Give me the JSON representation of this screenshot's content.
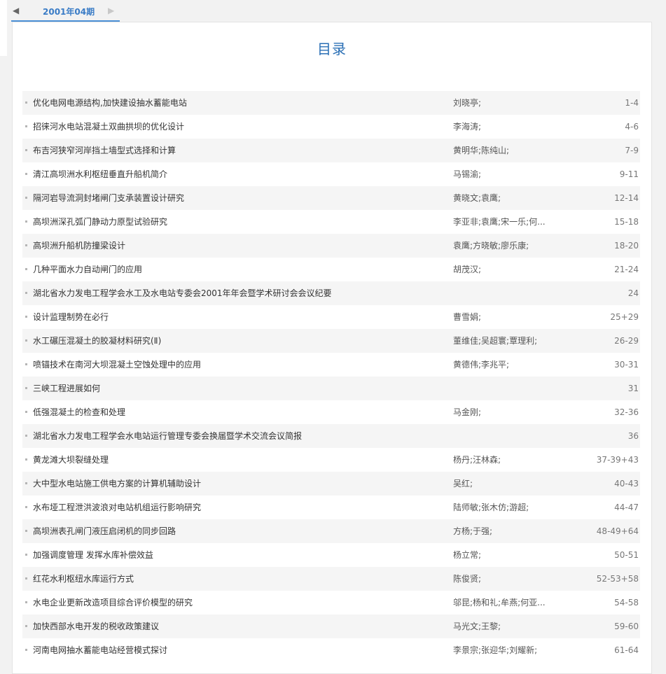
{
  "tabs": {
    "prev_icon": "◀",
    "next_icon": "▶",
    "active_label": "2001年04期"
  },
  "page_title": "目录",
  "articles": [
    {
      "title": "优化电网电源结构,加快建设抽水蓄能电站",
      "authors": "刘晓亭;",
      "pages": "1-4"
    },
    {
      "title": "招徕河水电站混凝土双曲拱坝的优化设计",
      "authors": "李海涛;",
      "pages": "4-6"
    },
    {
      "title": "布吉河狭窄河岸挡土墙型式选择和计算",
      "authors": "黄明华;陈纯山;",
      "pages": "7-9"
    },
    {
      "title": "清江高坝洲水利枢纽垂直升船机简介",
      "authors": "马锡渝;",
      "pages": "9-11"
    },
    {
      "title": "隔河岩导流洞封堵闸门支承装置设计研究",
      "authors": "黄晓文;袁鹰;",
      "pages": "12-14"
    },
    {
      "title": "高坝洲深孔弧门静动力原型试验研究",
      "authors": "李亚非;袁鹰;宋一乐;何...",
      "pages": "15-18"
    },
    {
      "title": "高坝洲升船机防撞梁设计",
      "authors": "袁鹰;方晓敏;廖乐康;",
      "pages": "18-20"
    },
    {
      "title": "几种平面水力自动闸门的应用",
      "authors": "胡茂汉;",
      "pages": "21-24"
    },
    {
      "title": "湖北省水力发电工程学会水工及水电站专委会2001年年会暨学术研讨会会议纪要",
      "authors": "",
      "pages": "24"
    },
    {
      "title": "设计监理制势在必行",
      "authors": "曹雪娟;",
      "pages": "25+29"
    },
    {
      "title": "水工碾压混凝土的胶凝材料研究(Ⅱ)",
      "authors": "董维佳;吴超寰;覃理利;",
      "pages": "26-29"
    },
    {
      "title": "喷锚技术在南河大坝混凝土空蚀处理中的应用",
      "authors": "黄德伟;李兆平;",
      "pages": "30-31"
    },
    {
      "title": "三峡工程进展如何",
      "authors": "",
      "pages": "31"
    },
    {
      "title": "低强混凝土的检查和处理",
      "authors": "马金刚;",
      "pages": "32-36"
    },
    {
      "title": "湖北省水力发电工程学会水电站运行管理专委会换届暨学术交流会议简报",
      "authors": "",
      "pages": "36"
    },
    {
      "title": "黄龙滩大坝裂缝处理",
      "authors": "杨丹;汪林森;",
      "pages": "37-39+43"
    },
    {
      "title": "大中型水电站施工供电方案的计算机辅助设计",
      "authors": "吴红;",
      "pages": "40-43"
    },
    {
      "title": "水布垭工程泄洪波浪对电站机组运行影响研究",
      "authors": "陆师敏;张木仿;游超;",
      "pages": "44-47"
    },
    {
      "title": "高坝洲表孔闸门液压启闭机的同步回路",
      "authors": "方杨;于强;",
      "pages": "48-49+64"
    },
    {
      "title": "加强调度管理 发挥水库补偿效益",
      "authors": "杨立常;",
      "pages": "50-51"
    },
    {
      "title": "红花水利枢纽水库运行方式",
      "authors": "陈俊贤;",
      "pages": "52-53+58"
    },
    {
      "title": "水电企业更新改造项目综合评价模型的研究",
      "authors": "邬昆;杨和礼;牟燕;何亚...",
      "pages": "54-58"
    },
    {
      "title": "加快西部水电开发的税收政策建议",
      "authors": "马光文;王黎;",
      "pages": "59-60"
    },
    {
      "title": "河南电网抽水蓄能电站经营模式探讨",
      "authors": "李景宗;张迎华;刘耀新;",
      "pages": "61-64"
    }
  ]
}
